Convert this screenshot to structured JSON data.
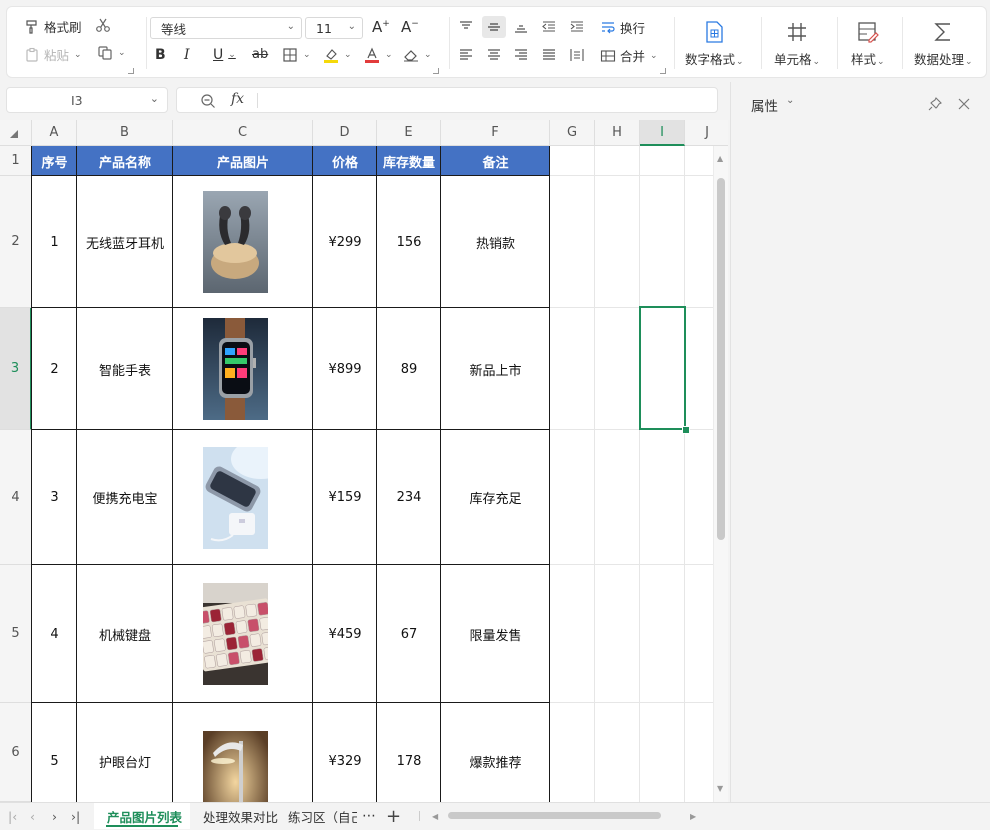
{
  "ribbon": {
    "format_painter": "格式刷",
    "paste": "粘贴",
    "font_name": "等线",
    "font_size": "11",
    "wrap": "换行",
    "merge": "合并",
    "number_format": "数字格式",
    "cell": "单元格",
    "style": "样式",
    "data_process": "数据处理",
    "bold": "B",
    "italic": "I",
    "underline": "U",
    "strike": "ab",
    "font_color_letter": "A",
    "highlight_color": "#f5d90a",
    "font_color": "#e23b3b"
  },
  "formula_bar": {
    "name_box": "I3",
    "fx": "fx",
    "value": ""
  },
  "panel": {
    "title": "属性"
  },
  "columns": [
    "A",
    "B",
    "C",
    "D",
    "E",
    "F",
    "G",
    "H",
    "I",
    "J"
  ],
  "rows": [
    "1",
    "2",
    "3",
    "4",
    "5",
    "6"
  ],
  "selected": {
    "column": "I",
    "row": "3"
  },
  "table": {
    "headers": [
      "序号",
      "产品名称",
      "产品图片",
      "价格",
      "库存数量",
      "备注"
    ],
    "rows": [
      {
        "no": "1",
        "name": "无线蓝牙耳机",
        "image": "earbuds-photo",
        "price": "¥299",
        "stock": "156",
        "note": "热销款"
      },
      {
        "no": "2",
        "name": "智能手表",
        "image": "smartwatch-photo",
        "price": "¥899",
        "stock": "89",
        "note": "新品上市"
      },
      {
        "no": "3",
        "name": "便携充电宝",
        "image": "powerbank-photo",
        "price": "¥159",
        "stock": "234",
        "note": "库存充足"
      },
      {
        "no": "4",
        "name": "机械键盘",
        "image": "keyboard-photo",
        "price": "¥459",
        "stock": "67",
        "note": "限量发售"
      },
      {
        "no": "5",
        "name": "护眼台灯",
        "image": "desk-lamp-photo",
        "price": "¥329",
        "stock": "178",
        "note": "爆款推荐"
      }
    ]
  },
  "sheet_tabs": [
    {
      "label": "产品图片列表",
      "active": true
    },
    {
      "label": "处理效果对比",
      "active": false
    },
    {
      "label": "练习区（自己",
      "active": false
    }
  ],
  "colors": {
    "header_fill": "#4472c4",
    "selection": "#1e8e5a",
    "active_tab": "#1e8e5a"
  }
}
